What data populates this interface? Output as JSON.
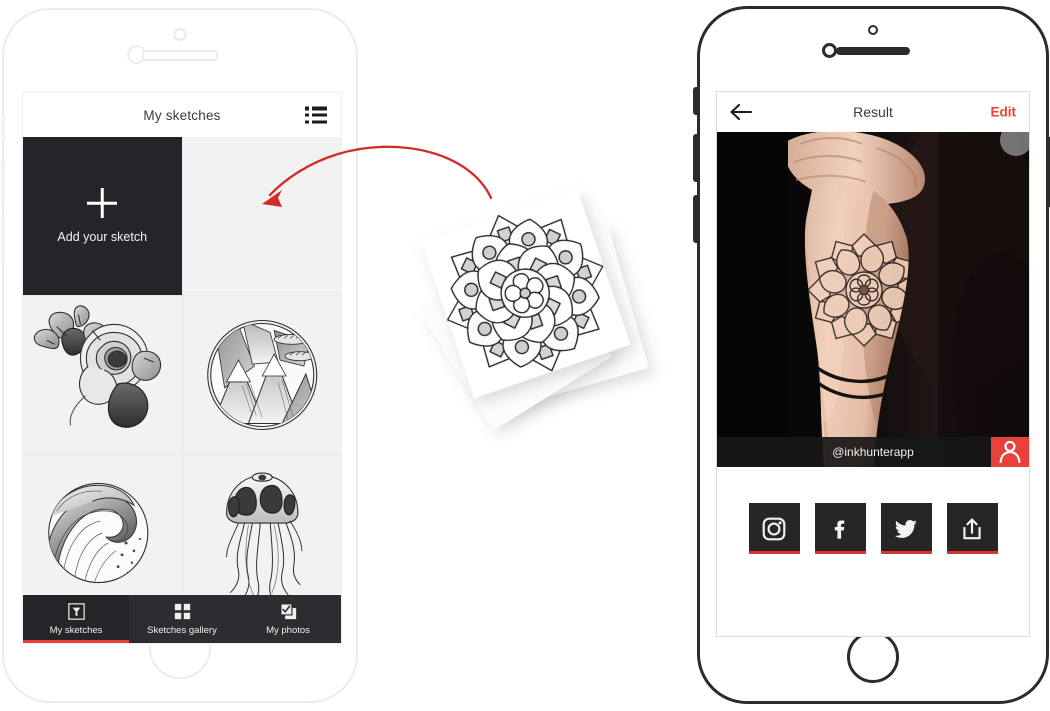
{
  "left_phone": {
    "name": "iphone-white-mockup",
    "screen": {
      "header": {
        "title": "My sketches",
        "menu_icon": "list-icon"
      },
      "grid": {
        "add_tile": {
          "label": "Add your sketch",
          "icon": "plus-icon"
        },
        "items": [
          {
            "name": "add-your-sketch-tile",
            "type": "action",
            "label": "Add your sketch"
          },
          {
            "name": "empty-slot-tile",
            "type": "empty",
            "label": ""
          },
          {
            "name": "sketch-rose",
            "type": "sketch",
            "label": "rose-sketch"
          },
          {
            "name": "sketch-mountains",
            "type": "sketch",
            "label": "mountain-circle-sketch"
          },
          {
            "name": "sketch-wave",
            "type": "sketch",
            "label": "ocean-wave-circle-sketch"
          },
          {
            "name": "sketch-jellyfish",
            "type": "sketch",
            "label": "jellyfish-sketch"
          }
        ]
      },
      "bottom_nav": {
        "active_index": 0,
        "tabs": [
          {
            "label": "My sketches",
            "icon": "pen-nib-square-icon"
          },
          {
            "label": "Sketches gallery",
            "icon": "grid-squares-icon"
          },
          {
            "label": "My photos",
            "icon": "checked-photos-icon"
          }
        ]
      }
    }
  },
  "right_phone": {
    "name": "iphone-dark-mockup",
    "screen": {
      "header": {
        "back_icon": "back-arrow-icon",
        "title": "Result",
        "edit_label": "Edit"
      },
      "photo": {
        "alt": "forearm-with-mandala-tattoo"
      },
      "watermark": {
        "text": "@inkhunterapp",
        "button_icon": "person-icon"
      },
      "share_buttons": [
        {
          "label": "Instagram",
          "icon": "instagram-icon"
        },
        {
          "label": "Facebook",
          "icon": "facebook-icon"
        },
        {
          "label": "Twitter",
          "icon": "twitter-icon"
        },
        {
          "label": "Share",
          "icon": "share-upload-icon"
        }
      ]
    }
  },
  "middle": {
    "papers": {
      "front": "mandala-sketch-paper",
      "back": "rose-sketch-paper"
    },
    "arrow": {
      "name": "curved-red-arrow",
      "direction": "right-to-left"
    }
  },
  "colors": {
    "accent_red": "#e8403a",
    "dark_panel": "#232528",
    "nav_bg": "#2b2d30",
    "screen_bg": "#f2f2f2",
    "frame_dark": "#2b2b2b",
    "frame_light": "#ececec"
  }
}
